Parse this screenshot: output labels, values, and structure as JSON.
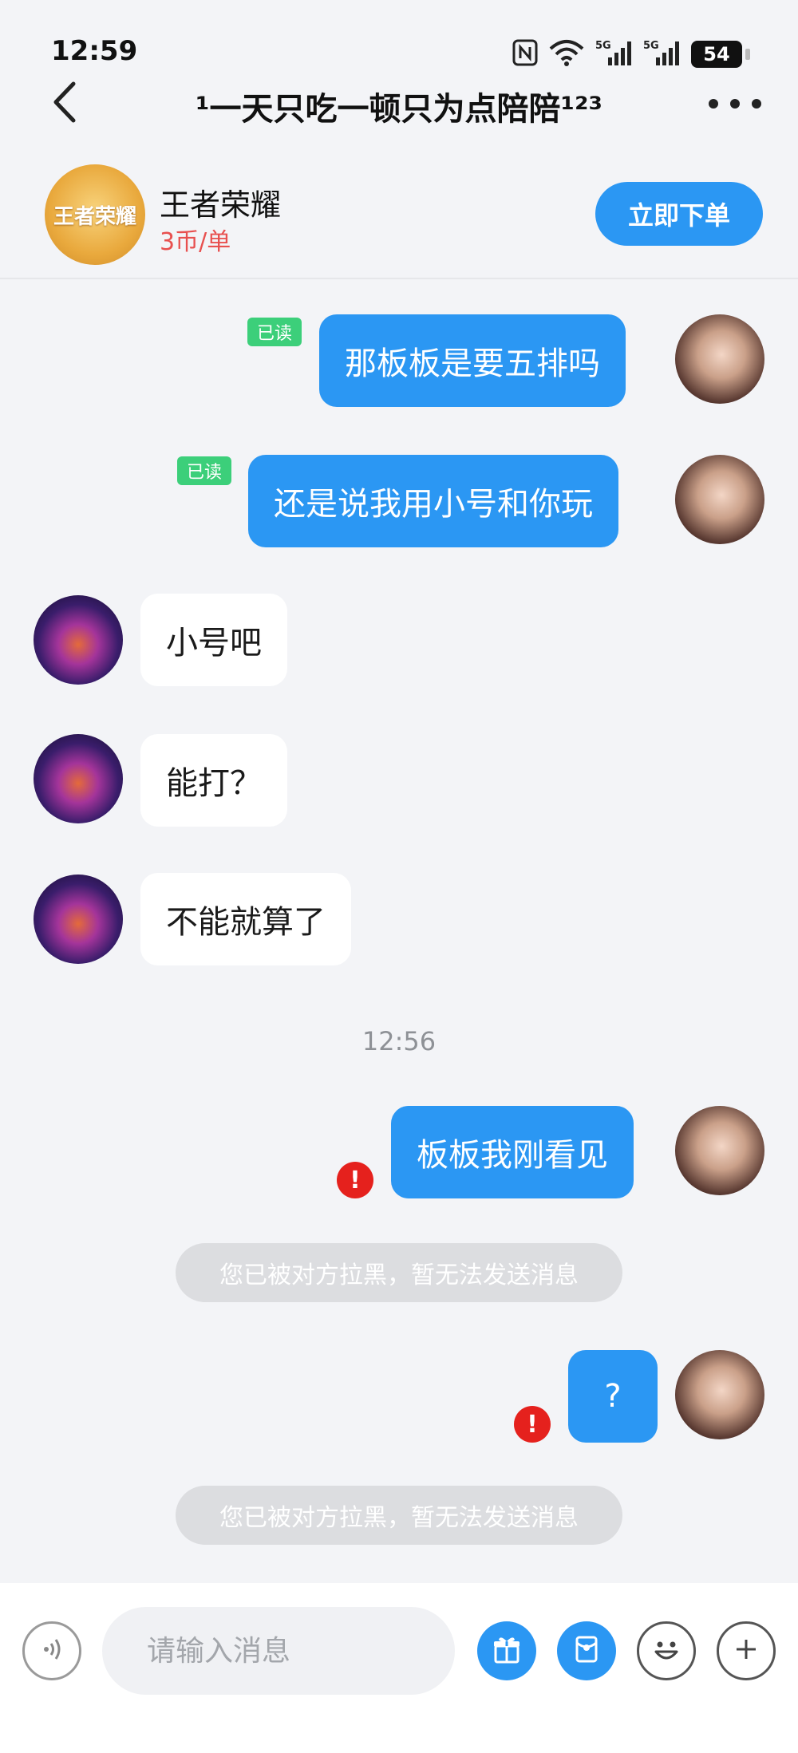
{
  "status_bar": {
    "time": "12:59",
    "battery": "54",
    "network_1": "5G",
    "network_2": "5G"
  },
  "header": {
    "title": "¹一天只吃一顿只为点陪陪¹²³"
  },
  "order_card": {
    "game_name": "王者荣耀",
    "logo_text": "王者荣耀",
    "price": "3币/单",
    "order_button": "立即下单"
  },
  "messages": [
    {
      "side": "out",
      "text": "那板板是要五排吗",
      "status": "已读"
    },
    {
      "side": "out",
      "text": "还是说我用小号和你玩",
      "status": "已读"
    },
    {
      "side": "in",
      "text": "小号吧"
    },
    {
      "side": "in",
      "text": "能打？"
    },
    {
      "side": "in",
      "text": "不能就算了"
    },
    {
      "side": "divider",
      "text": "12:56"
    },
    {
      "side": "out",
      "text": "板板我刚看见",
      "status": "!"
    },
    {
      "side": "system",
      "text": "您已被对方拉黑，暂无法发送消息"
    },
    {
      "side": "out",
      "text": "?",
      "status": "!"
    },
    {
      "side": "system",
      "text": "您已被对方拉黑，暂无法发送消息"
    }
  ],
  "input_bar": {
    "placeholder": "请输入消息"
  },
  "icons": {
    "back": "back-arrow-icon",
    "more": "more-dots-icon",
    "voice": "voice-icon",
    "gift": "gift-icon",
    "red_packet": "red-packet-icon",
    "emoji": "emoji-icon",
    "plus": "plus-icon"
  },
  "colors": {
    "accent": "#2b97f3",
    "price": "#e8504f",
    "read_tag": "#3ccf7a",
    "error": "#e5211d",
    "background": "#f3f4f7"
  }
}
